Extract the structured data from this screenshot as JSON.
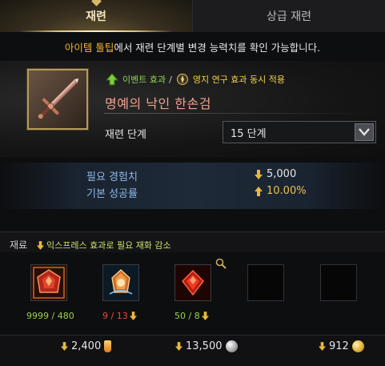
{
  "tabs": [
    {
      "label": "재련",
      "active": true
    },
    {
      "label": "상급 재련",
      "active": false
    }
  ],
  "notice": {
    "highlight": "아이템 툴팁",
    "rest": "에서 재련 단계별 변경 능력치를 확인 가능합니다."
  },
  "item": {
    "event_effect": "이벤트 효과",
    "separator": "/",
    "territory_effect": "영지 연구 효과 동시 적용",
    "name": "명예의 낙인 한손검",
    "icon": "sword-icon"
  },
  "stage": {
    "label": "재련 단계",
    "selected": "15 단계"
  },
  "stats": {
    "exp_label": "필요 경험치",
    "exp_value": "5,000",
    "rate_label": "기본 성공률",
    "rate_value": "10.00%"
  },
  "materials": {
    "title": "재료",
    "express_note": "익스프레스 효과로 필요 재화 감소",
    "slots": [
      {
        "icon": "red-stone-icon",
        "count": "9999 / 480",
        "status": "enough"
      },
      {
        "icon": "crystal-stone-icon",
        "count": "9 / 13",
        "status": "lacking"
      },
      {
        "icon": "fire-gem-icon",
        "count": "50 / 8",
        "status": "enough"
      },
      {
        "icon": "empty-slot",
        "count": ""
      },
      {
        "icon": "empty-slot",
        "count": ""
      }
    ]
  },
  "costs": {
    "shard": "2,400",
    "silver": "13,500",
    "gold": "912"
  },
  "colors": {
    "accent_gold": "#d6b86b",
    "highlight_orange": "#f3b42b",
    "item_name": "#f0a090",
    "stat_label_blue": "#8fb7e6",
    "success_gold": "#e9c34a",
    "count_green": "#9bd04a",
    "count_red": "#ef4a3a"
  }
}
